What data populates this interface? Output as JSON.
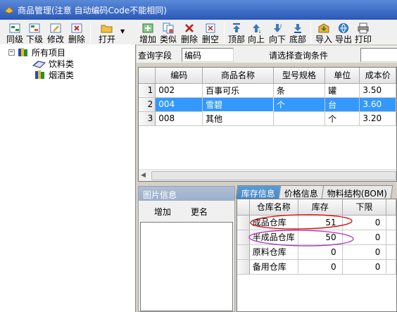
{
  "window": {
    "title": "商品管理(注意 自动编码Code不能相同)"
  },
  "toolbar_left": [
    {
      "label": "同级",
      "icon": "add-sibling-icon"
    },
    {
      "label": "下级",
      "icon": "add-child-icon"
    },
    {
      "label": "修改",
      "icon": "edit-icon"
    },
    {
      "label": "删除",
      "icon": "delete-icon"
    },
    {
      "label": "打开",
      "icon": "open-folder-icon"
    }
  ],
  "toolbar_right": [
    {
      "label": "增加",
      "icon": "add-icon"
    },
    {
      "label": "类似",
      "icon": "copy-similar-icon"
    },
    {
      "label": "删除",
      "icon": "delete-x-icon"
    },
    {
      "label": "删空",
      "icon": "clear-icon"
    },
    {
      "label": "顶部",
      "icon": "move-top-icon"
    },
    {
      "label": "向上",
      "icon": "move-up-icon"
    },
    {
      "label": "向下",
      "icon": "move-down-icon"
    },
    {
      "label": "底部",
      "icon": "move-bottom-icon"
    },
    {
      "label": "导入",
      "icon": "import-icon"
    },
    {
      "label": "导出",
      "icon": "export-icon"
    },
    {
      "label": "打印",
      "icon": "print-icon"
    }
  ],
  "tree": {
    "root": "所有项目",
    "children": [
      "饮料类",
      "烟酒类"
    ]
  },
  "query": {
    "field_label": "查询字段",
    "field_value": "编码",
    "condition_label": "请选择查询条件",
    "condition_value": ""
  },
  "grid": {
    "columns": [
      "编码",
      "商品名称",
      "型号规格",
      "单位",
      "成本价"
    ],
    "rows": [
      {
        "no": "1",
        "code": "002",
        "name": "百事可乐",
        "spec": "条",
        "unit": "罐",
        "cost": "3.50"
      },
      {
        "no": "2",
        "code": "004",
        "name": "雪碧",
        "spec": "个",
        "unit": "台",
        "cost": "3.60"
      },
      {
        "no": "3",
        "code": "008",
        "name": "其他",
        "spec": "",
        "unit": "个",
        "cost": "3.20"
      }
    ],
    "selected_row": 2
  },
  "image_panel": {
    "title": "图片信息",
    "add_label": "增加",
    "rename_label": "更名"
  },
  "tabs": [
    "库存信息",
    "价格信息",
    "物料结构(BOM)"
  ],
  "stock": {
    "columns": [
      "仓库名称",
      "库存",
      "下限"
    ],
    "rows": [
      {
        "name": "成品仓库",
        "qty": "51",
        "min": "0"
      },
      {
        "name": "半成品仓库",
        "qty": "50",
        "min": "0"
      },
      {
        "name": "原料仓库",
        "qty": "0",
        "min": "0"
      },
      {
        "name": "备用仓库",
        "qty": "0",
        "min": "0"
      }
    ]
  },
  "colors": {
    "selection": "#3399ff",
    "annotation_red": "#d40000",
    "annotation_purple": "#b030c0",
    "active_tab": "#4a87c6"
  }
}
